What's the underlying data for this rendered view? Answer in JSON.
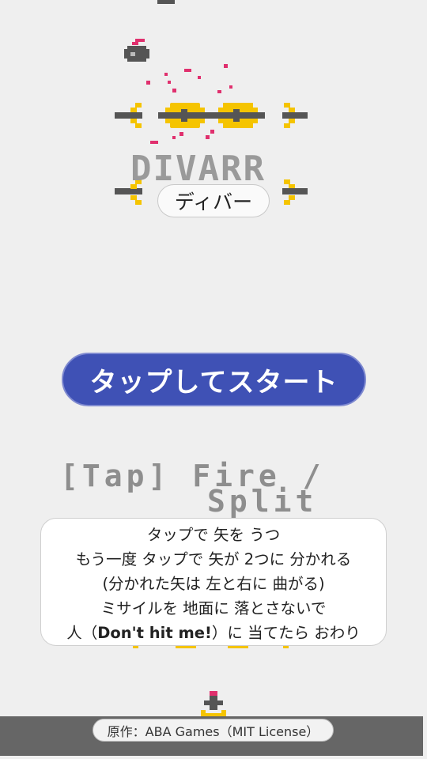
{
  "title": {
    "pixel_text": "DIVARR",
    "japanese_label": "ディバー"
  },
  "start_button": {
    "label": "タップしてスタート"
  },
  "pixel_help": {
    "line1": "[Tap] Fire /",
    "line2": "Split"
  },
  "instructions": {
    "line1": "タップで 矢を うつ",
    "line2": "もう一度 タップで 矢が 2つに 分かれる",
    "line3": "(分かれた矢は 左と右に 曲がる)",
    "line4": "ミサイルを 地面に 落とさないで",
    "line5_prefix": "人（",
    "line5_bold": "Don't hit me!",
    "line5_suffix": "）に 当てたら おわり"
  },
  "credit": {
    "text": "原作：ABA Games（MIT License）"
  },
  "colors": {
    "background": "#efefef",
    "button": "#3f51b5",
    "arrow_gray": "#555555",
    "arrow_yellow": "#f5c400",
    "spark": "#e0306e",
    "ground": "#666666"
  }
}
